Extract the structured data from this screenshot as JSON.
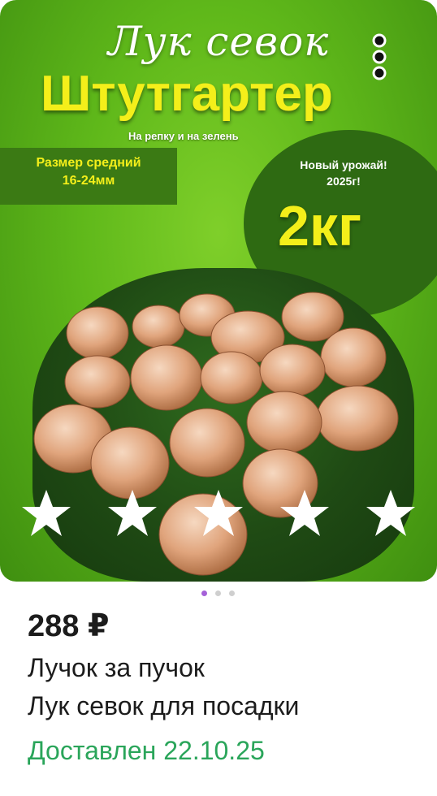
{
  "product": {
    "image": {
      "title_line1": "Лук севок",
      "title_line2": "Штутгартер",
      "subtitle": "На репку и на зелень",
      "size_label_line1": "Размер средний",
      "size_label_line2": "16-24мм",
      "harvest_line1": "Новый урожай!",
      "harvest_line2": "2025г!",
      "weight": "2кг"
    },
    "rating_icons": [
      "star-icon",
      "star-icon",
      "star-icon",
      "star-icon",
      "star-icon"
    ],
    "more_icon": "more-vertical-icon",
    "carousel": {
      "total": 3,
      "active": 1
    },
    "price": "288 ₽",
    "name_line1": "Лучок за пучок",
    "name_line2": "Лук севок для посадки",
    "delivery_status": "Доставлен 22.10.25"
  },
  "colors": {
    "accent_purple": "#a561d8",
    "dot_inactive": "#cfcfcf",
    "delivery_green": "#2aa55a",
    "yellow": "#f4ef1a",
    "grass_green": "#5fb81a"
  }
}
